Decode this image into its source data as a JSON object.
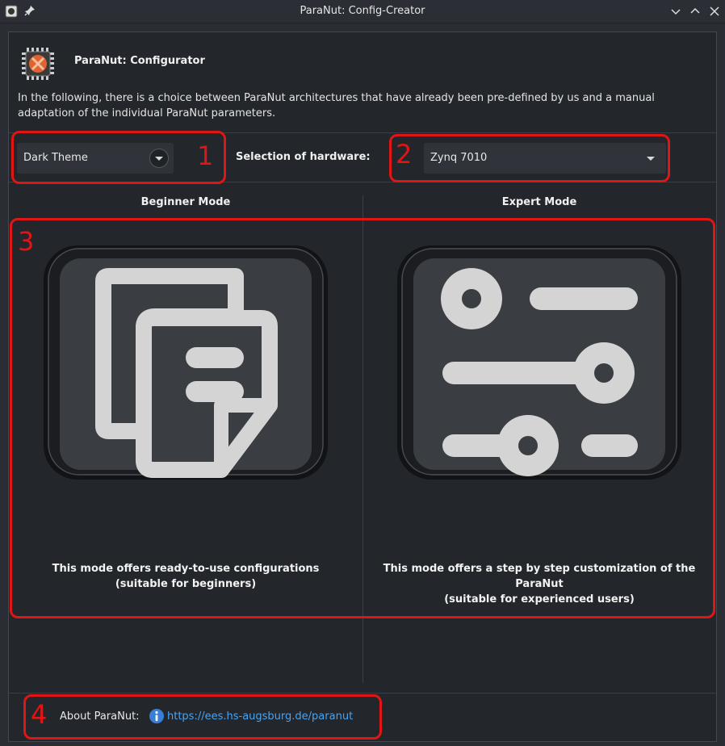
{
  "window": {
    "title": "ParaNut: Config-Creator"
  },
  "header": {
    "title": "ParaNut: Configurator",
    "intro": "In the following, there is a choice between ParaNut architectures that have already been pre-defined by us and a manual adaptation of the individual ParaNut parameters."
  },
  "theme": {
    "selected": "Dark Theme"
  },
  "hardware": {
    "label": "Selection of hardware:",
    "selected": "Zynq 7010"
  },
  "beginner": {
    "title": "Beginner Mode",
    "desc_line1": "This mode offers ready-to-use configurations",
    "desc_line2": "(suitable for beginners)",
    "icon": "documents-icon"
  },
  "expert": {
    "title": "Expert Mode",
    "desc_line1": "This mode offers a step by step customization of the ParaNut",
    "desc_line2": "(suitable for experienced users)",
    "icon": "sliders-icon"
  },
  "about": {
    "label": "About ParaNut:",
    "link": "https://ees.hs-augsburg.de/paranut"
  },
  "annotations": {
    "n1": "1",
    "n2": "2",
    "n3": "3",
    "n4": "4"
  },
  "colors": {
    "background": "#23262b",
    "annotation": "#e01515",
    "link": "#4aa3f0"
  }
}
